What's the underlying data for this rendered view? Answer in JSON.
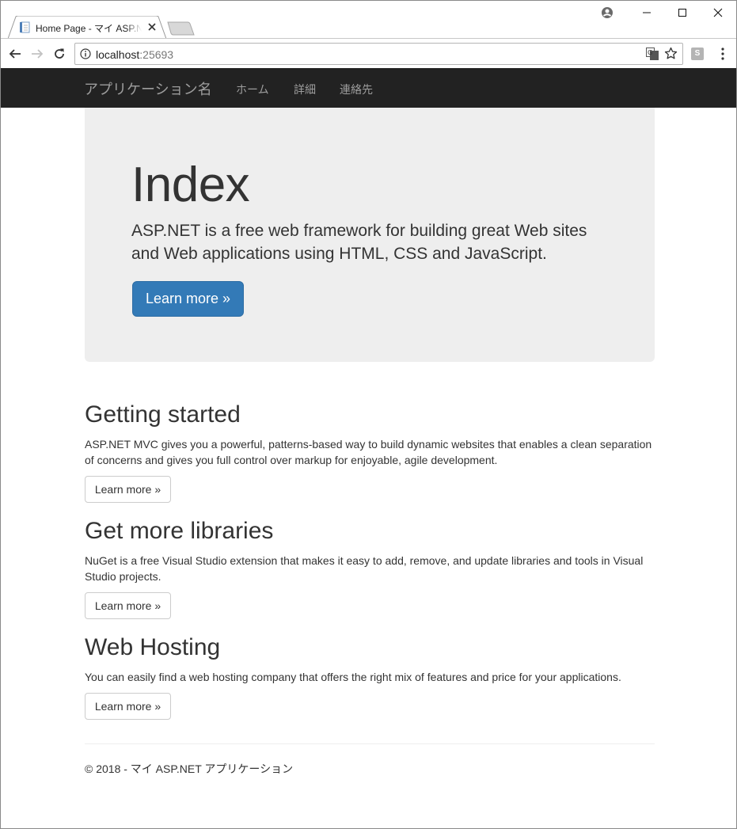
{
  "browser": {
    "tab_title": "Home Page - マイ ASP.NET アプリケーション",
    "url_host": "localhost",
    "url_port": ":25693",
    "extension_label": "S"
  },
  "navbar": {
    "brand": "アプリケーション名",
    "links": [
      "ホーム",
      "詳細",
      "連絡先"
    ]
  },
  "jumbotron": {
    "heading": "Index",
    "lead_line1": "ASP.NET is a free web framework for building great Web sites",
    "lead_line2": "and Web applications using HTML, CSS and JavaScript.",
    "button_label": "Learn more »"
  },
  "sections": [
    {
      "title": "Getting started",
      "text_line1": "ASP.NET MVC gives you a powerful, patterns-based way to build dynamic websites that enables a clean separation",
      "text_line2": "of concerns and gives you full control over markup for enjoyable, agile development.",
      "button_label": "Learn more »"
    },
    {
      "title": "Get more libraries",
      "text_line1": "NuGet is a free Visual Studio extension that makes it easy to add, remove, and update libraries and tools in Visual",
      "text_line2": "Studio projects.",
      "button_label": "Learn more »"
    },
    {
      "title": "Web Hosting",
      "text_line1": "You can easily find a web hosting company that offers the right mix of features and price for your applications.",
      "button_label": "Learn more »"
    }
  ],
  "footer": {
    "copyright": "© 2018 - マイ ASP.NET アプリケーション"
  },
  "colors": {
    "navbar_bg": "#222222",
    "navbar_text": "#9d9d9d",
    "jumbotron_bg": "#eeeeee",
    "primary": "#337ab7"
  },
  "icons": [
    "page-favicon",
    "close-icon",
    "new-tab",
    "profile-icon",
    "minimize-icon",
    "maximize-icon",
    "window-close-icon",
    "back-arrow-icon",
    "forward-arrow-icon",
    "reload-icon",
    "info-icon",
    "translate-icon",
    "star-icon",
    "menu-dots-icon"
  ]
}
